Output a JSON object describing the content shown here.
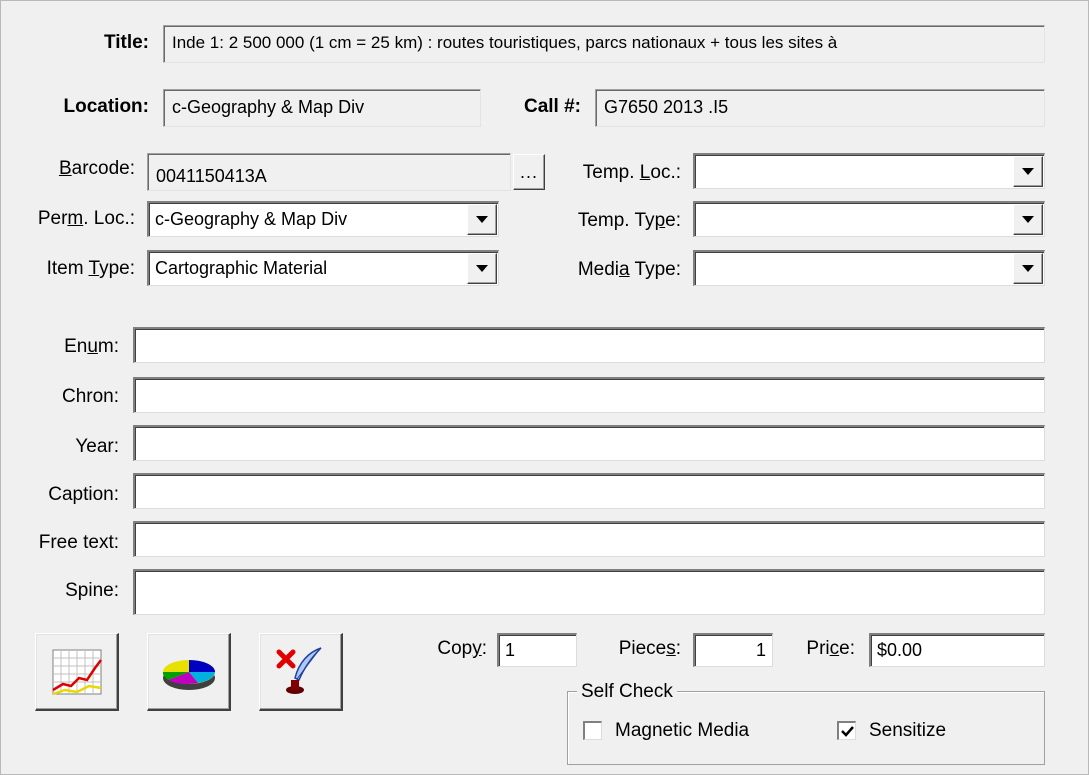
{
  "header": {
    "title_label": "Title:",
    "title_value": "Inde 1: 2 500 000 (1 cm = 25 km) : routes touristiques, parcs nationaux + tous les sites à",
    "location_label": "Location:",
    "location_value": "c-Geography & Map Div",
    "call_label": "Call #:",
    "call_value": "G7650 2013 .I5"
  },
  "fields": {
    "barcode": {
      "pre": "",
      "ul": "B",
      "post": "arcode:",
      "value": "0041150413A",
      "ellipsis": "..."
    },
    "perm_loc": {
      "pre": "Per",
      "ul": "m",
      "post": ". Loc.:",
      "value": "c-Geography & Map Div"
    },
    "item_type": {
      "pre": "Item ",
      "ul": "T",
      "post": "ype:",
      "value": "Cartographic Material"
    },
    "temp_loc": {
      "pre": "Temp. ",
      "ul": "L",
      "post": "oc.:",
      "value": ""
    },
    "temp_type": {
      "pre": "Temp. Ty",
      "ul": "p",
      "post": "e:",
      "value": ""
    },
    "media_type": {
      "pre": "Medi",
      "ul": "a",
      "post": " Type:",
      "value": ""
    }
  },
  "text_fields": {
    "enum": {
      "pre": "En",
      "ul": "u",
      "post": "m:",
      "value": ""
    },
    "chron": {
      "label": "Chron:",
      "value": ""
    },
    "year": {
      "label": "Year:",
      "value": ""
    },
    "caption": {
      "label": "Caption:",
      "value": ""
    },
    "free_text": {
      "label": "Free text:",
      "value": ""
    },
    "spine": {
      "label": "Spine:",
      "value": ""
    }
  },
  "counts": {
    "copy": {
      "pre": "Cop",
      "ul": "y",
      "post": ":",
      "value": "1"
    },
    "pieces": {
      "pre": "Piece",
      "ul": "s",
      "post": ":",
      "value": "1"
    },
    "price": {
      "pre": "Pri",
      "ul": "c",
      "post": "e:",
      "value": "$0.00"
    }
  },
  "self_check": {
    "title": "Self Check",
    "magnetic_media": {
      "label": "Magnetic Media",
      "checked": false
    },
    "sensitize": {
      "label": "Sensitize",
      "checked": true
    }
  },
  "icons": {
    "chart_button": "line-chart-icon",
    "pie_button": "pie-chart-icon",
    "delete_button": "delete-quill-icon"
  },
  "colors": {
    "window_bg": "#f0f0f0",
    "field_bg": "#ffffff"
  }
}
